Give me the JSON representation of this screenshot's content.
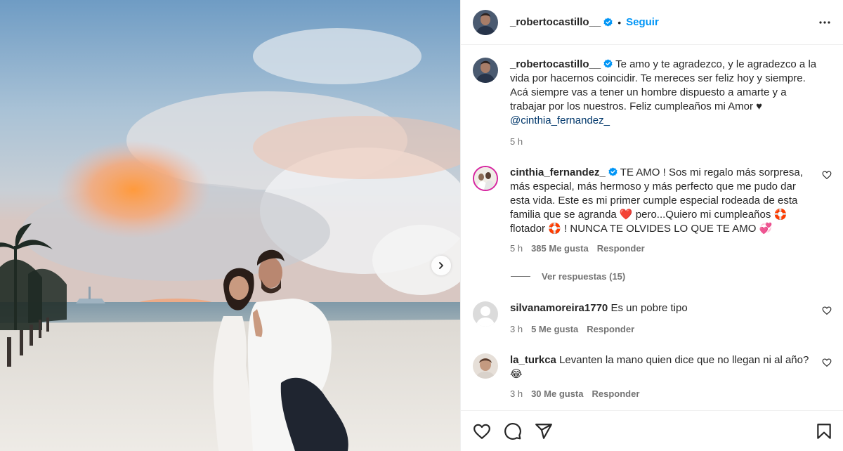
{
  "post": {
    "author": "_robertocastillo__",
    "dot": "•",
    "follow_label": "Seguir",
    "caption": {
      "text": "Te amo y te agradezco, y le agradezco a la vida por hacernos coincidir. Te mereces ser feliz hoy y siempre. Acá siempre vas a tener un hombre dispuesto a amarte y a trabajar por los nuestros. Feliz cumpleaños mi Amor ♥",
      "mention": "@cinthia_fernandez_",
      "time": "5 h"
    }
  },
  "comments": [
    {
      "user": "cinthia_fernandez_",
      "verified": true,
      "text": "TE AMO ! Sos mi regalo más sorpresa, más especial, más hermoso y más perfecto que me pudo dar esta vida. Este es mi primer cumple especial rodeada de esta familia que se agranda ❤️ pero...Quiero mi cumpleaños 🛟 flotador 🛟 ! NUNCA TE OLVIDES LO QUE TE AMO 💞",
      "time": "5 h",
      "likes": "385 Me gusta",
      "reply": "Responder",
      "view_replies": "Ver respuestas (15)"
    },
    {
      "user": "silvanamoreira1770",
      "text": "Es un pobre tipo",
      "time": "3 h",
      "likes": "5 Me gusta",
      "reply": "Responder"
    },
    {
      "user": "la_turkca",
      "text": "Levanten la mano quien dice que no llegan ni al año? 😂",
      "time": "3 h",
      "likes": "30 Me gusta",
      "reply": "Responder"
    }
  ],
  "icons": {
    "header_more": "more-horizontal-icon",
    "carousel_next": "chevron-right-icon",
    "like": "heart-icon",
    "comment": "comment-icon",
    "share": "share-icon",
    "save": "bookmark-icon",
    "verified": "verified-badge-icon"
  },
  "colors": {
    "accent": "#0095f6",
    "verified": "#0095f6",
    "text": "#262626",
    "muted": "#737373"
  }
}
